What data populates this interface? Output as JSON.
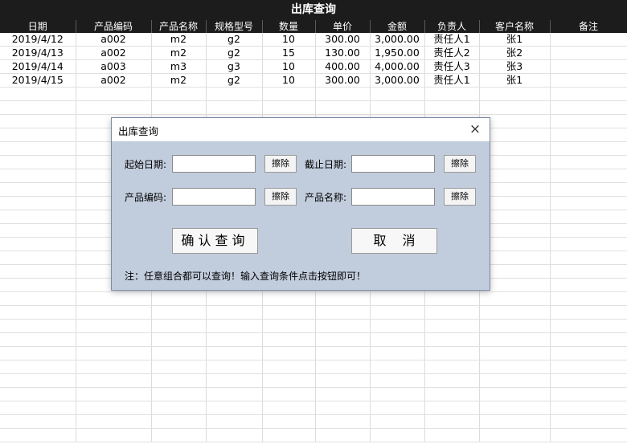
{
  "sheet": {
    "title": "出库查询",
    "columns": [
      "日期",
      "产品编码",
      "产品名称",
      "规格型号",
      "数量",
      "单价",
      "金额",
      "负责人",
      "客户名称",
      "备注"
    ],
    "rows": [
      [
        "2019/4/12",
        "a002",
        "m2",
        "g2",
        "10",
        "300.00",
        "3,000.00",
        "责任人1",
        "张1",
        ""
      ],
      [
        "2019/4/13",
        "a002",
        "m2",
        "g2",
        "15",
        "130.00",
        "1,950.00",
        "责任人2",
        "张2",
        ""
      ],
      [
        "2019/4/14",
        "a003",
        "m3",
        "g3",
        "10",
        "400.00",
        "4,000.00",
        "责任人3",
        "张3",
        ""
      ],
      [
        "2019/4/15",
        "a002",
        "m2",
        "g2",
        "10",
        "300.00",
        "3,000.00",
        "责任人1",
        "张1",
        ""
      ]
    ]
  },
  "dialog": {
    "title": "出库查询",
    "close_icon": "×",
    "start_date_label": "起始日期:",
    "end_date_label": "截止日期:",
    "product_code_label": "产品编码:",
    "product_name_label": "产品名称:",
    "start_date_value": "",
    "end_date_value": "",
    "product_code_value": "",
    "product_name_value": "",
    "clear_label": "擦除",
    "confirm_label": "确认查询",
    "cancel_label": "取消",
    "note": "注：任意组合都可以查询！输入查询条件点击按钮即可！"
  }
}
